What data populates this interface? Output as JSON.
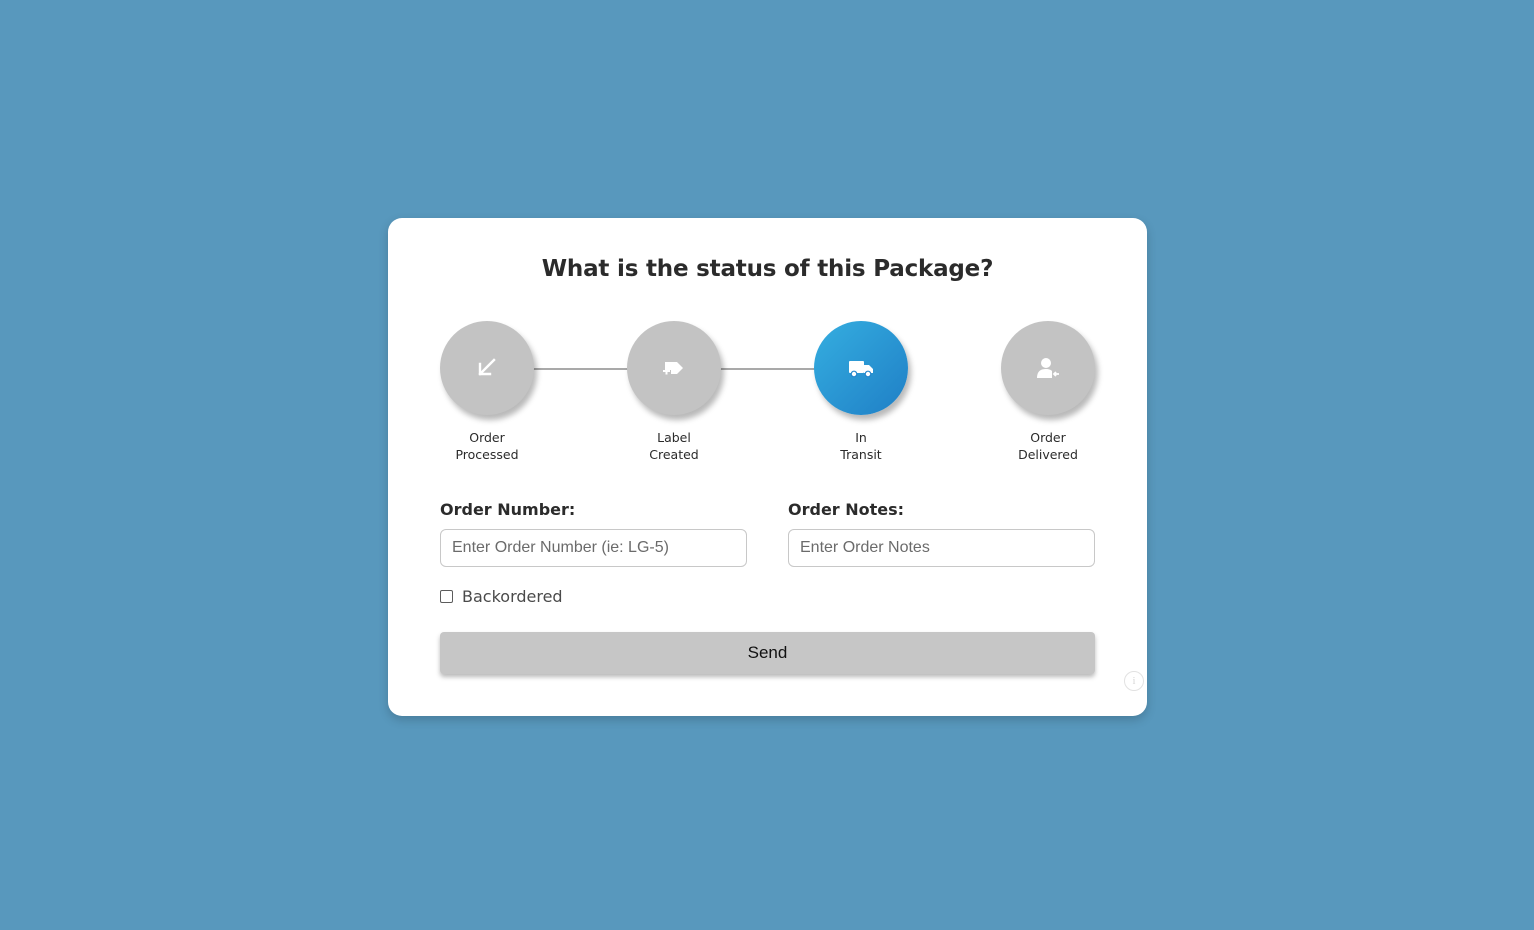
{
  "page": {
    "background_color": "#5898bd"
  },
  "card": {
    "title": "What is the status of this Package?"
  },
  "steps": [
    {
      "line1": "Order",
      "line2": "Processed",
      "icon": "arrow-down-left-icon",
      "active": false
    },
    {
      "line1": "Label",
      "line2": "Created",
      "icon": "label-tag-icon",
      "active": false
    },
    {
      "line1": "In",
      "line2": "Transit",
      "icon": "truck-icon",
      "active": true
    },
    {
      "line1": "Order",
      "line2": "Delivered",
      "icon": "user-delivered-icon",
      "active": false
    }
  ],
  "colors": {
    "active_step": "#2a96d6",
    "inactive_step": "#c3c3c3",
    "button": "#c6c6c6"
  },
  "form": {
    "order_number": {
      "label": "Order Number:",
      "placeholder": "Enter Order Number (ie: LG-5)",
      "value": ""
    },
    "order_notes": {
      "label": "Order Notes:",
      "placeholder": "Enter Order Notes",
      "value": ""
    },
    "backordered": {
      "label": "Backordered",
      "checked": false
    },
    "send_label": "Send"
  },
  "info_icon": {
    "glyph": "i"
  }
}
